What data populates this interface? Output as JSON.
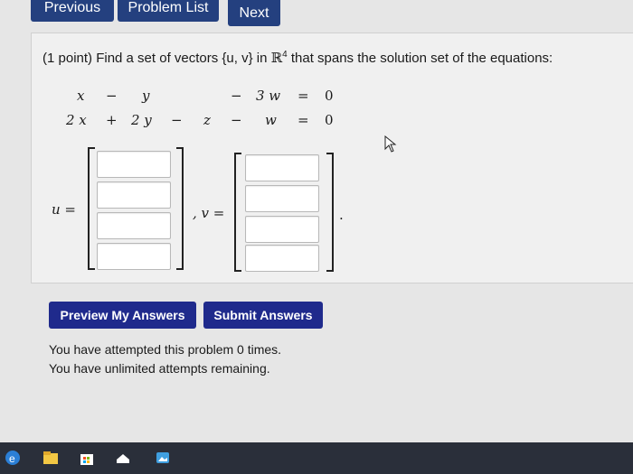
{
  "nav": {
    "previous": "Previous",
    "problem_list": "Problem List",
    "next": "Next"
  },
  "problem": {
    "prompt_prefix": "(1 point) Find a set of vectors {u, v} in ",
    "space_symbol": "ℝ",
    "space_dim": "4",
    "prompt_suffix": " that spans the solution set of the equations:",
    "eq1": [
      "x",
      "−",
      "y",
      "",
      "",
      "−",
      "3 w",
      "=",
      "0"
    ],
    "eq2": [
      "2 x",
      "+",
      "2 y",
      "−",
      "z",
      "−",
      "w",
      "=",
      "0"
    ],
    "u_label": "u =",
    "v_label": ", v =",
    "trailing_period": ".",
    "u_entries": [
      "",
      "",
      "",
      ""
    ],
    "v_entries": [
      "",
      "",
      "",
      ""
    ]
  },
  "actions": {
    "preview": "Preview My Answers",
    "submit": "Submit Answers"
  },
  "status": {
    "attempts": "You have attempted this problem 0 times.",
    "remaining": "You have unlimited attempts remaining."
  },
  "taskbar": {
    "icons": [
      "edge-icon",
      "file-explorer-icon",
      "store-icon",
      "mail-icon",
      "photos-icon"
    ]
  }
}
